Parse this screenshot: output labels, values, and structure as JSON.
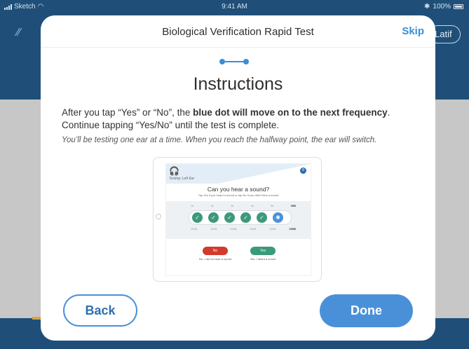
{
  "status_bar": {
    "carrier": "Sketch",
    "time": "9:41 AM",
    "battery": "100%"
  },
  "background_app": {
    "profile_label": "Latif"
  },
  "modal": {
    "title": "Biological Verification Rapid Test",
    "skip_label": "Skip",
    "heading": "Instructions",
    "instruction_part1": "After you tap “Yes” or “No”, the ",
    "instruction_bold": "blue dot will move on to the next frequency",
    "instruction_part2": ". Continue tapping “Yes/No” until the test is complete.",
    "note": "You’ll be testing one ear at a time. When you reach the halfway point, the ear will switch.",
    "back_label": "Back",
    "done_label": "Done"
  },
  "illustration": {
    "testing_label": "Testing: Left Ear",
    "badge": "8",
    "question": "Can you hear a sound?",
    "subtext": "Tap Yes if you heard a sound or tap No if you didn't hear a sound",
    "top_labels": [
      "1k",
      "2k",
      "3k",
      "4k",
      "5k",
      "30B"
    ],
    "bottom_labels": [
      "250B",
      "250B",
      "250B",
      "250B",
      "250B",
      "250B"
    ],
    "no_label": "No",
    "yes_label": "Yes",
    "no_caption": "No, I did not hear a sound",
    "yes_caption": "Yes, I heard a sound"
  },
  "colors": {
    "accent": "#4a90d9",
    "check_green": "#3a9a7a",
    "no_red": "#d33a2c",
    "app_blue": "#1f4f78"
  }
}
